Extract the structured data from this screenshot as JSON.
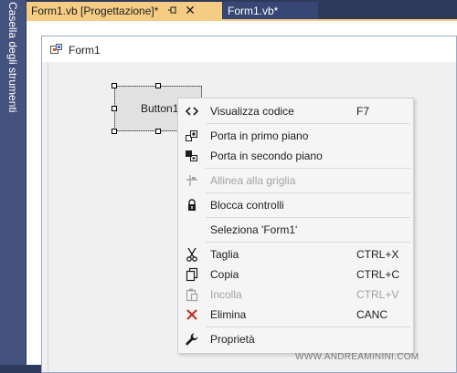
{
  "toolbox": {
    "label": "Casella degli strumenti"
  },
  "tabs": [
    {
      "label": "Form1.vb [Progettazione]*",
      "active": true
    },
    {
      "label": "Form1.vb*",
      "active": false
    }
  ],
  "form": {
    "title": "Form1"
  },
  "button": {
    "label": "Button1"
  },
  "context_menu": {
    "items": [
      {
        "icon": "code-icon",
        "label": "Visualizza codice",
        "shortcut": "F7",
        "enabled": true
      },
      {
        "icon": "bring-to-front-icon",
        "label": "Porta in primo piano",
        "shortcut": "",
        "enabled": true
      },
      {
        "icon": "send-to-back-icon",
        "label": "Porta in secondo piano",
        "shortcut": "",
        "enabled": true
      },
      {
        "icon": "align-to-grid-icon",
        "label": "Allinea alla griglia",
        "shortcut": "",
        "enabled": false
      },
      {
        "icon": "lock-icon",
        "label": "Blocca controlli",
        "shortcut": "",
        "enabled": true
      },
      {
        "icon": "",
        "label": "Seleziona 'Form1'",
        "shortcut": "",
        "enabled": true
      },
      {
        "icon": "scissors-icon",
        "label": "Taglia",
        "shortcut": "CTRL+X",
        "enabled": true
      },
      {
        "icon": "copy-icon",
        "label": "Copia",
        "shortcut": "CTRL+C",
        "enabled": true
      },
      {
        "icon": "paste-icon",
        "label": "Incolla",
        "shortcut": "CTRL+V",
        "enabled": false
      },
      {
        "icon": "delete-icon",
        "label": "Elimina",
        "shortcut": "CANC",
        "enabled": true
      },
      {
        "icon": "wrench-icon",
        "label": "Proprietà",
        "shortcut": "",
        "enabled": true
      }
    ]
  },
  "watermark": "WWW.ANDREAMININI.COM",
  "colors": {
    "ide_background": "#2e3a5c",
    "active_tab": "#f5cc84",
    "inactive_tab": "#364775",
    "delete_icon": "#c42b1c"
  }
}
